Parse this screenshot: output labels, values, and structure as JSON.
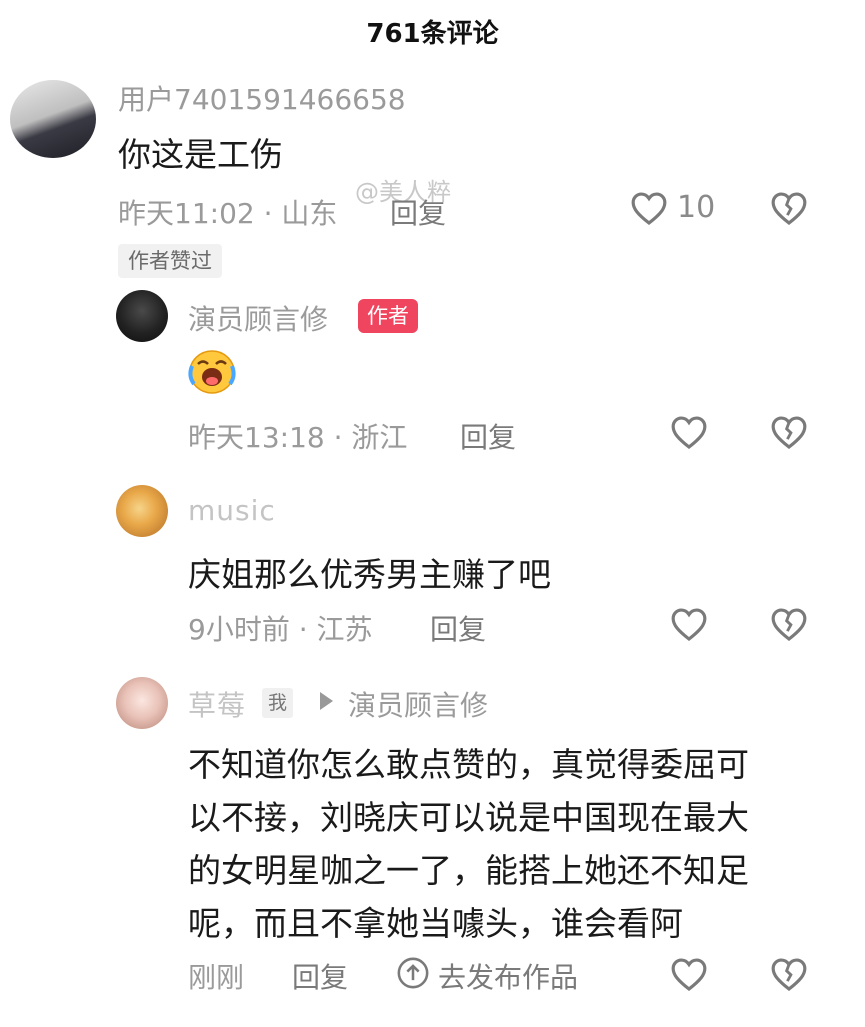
{
  "header": {
    "title": "761条评论"
  },
  "watermark": "@美人粹",
  "comments": [
    {
      "user": "用户7401591466658",
      "text": "你这是工伤",
      "meta": "昨天11:02 · 山东",
      "reply_label": "回复",
      "like_count": "10",
      "badge": "作者赞过"
    },
    {
      "user": "演员顾言修",
      "author_badge": "作者",
      "meta": "昨天13:18 · 浙江",
      "reply_label": "回复"
    },
    {
      "user": "music",
      "text": "庆姐那么优秀男主赚了吧",
      "meta": "9小时前 · 江苏",
      "reply_label": "回复"
    },
    {
      "user": "草莓",
      "me_tag": "我",
      "reply_to": "演员顾言修",
      "text_lines": [
        "不知道你怎么敢点赞的，真觉得委屈可",
        "以不接，刘晓庆可以说是中国现在最大",
        "的女明星咖之一了，能搭上她还不知足",
        "呢，而且不拿她当噱头，谁会看阿"
      ],
      "meta": "刚刚",
      "reply_label": "回复",
      "publish_label": "去发布作品"
    }
  ],
  "icons": {
    "like": "heart-outline-icon",
    "dislike": "broken-heart-icon",
    "publish": "upload-circle-icon",
    "emoji": "laughing-crying-emoji"
  },
  "colors": {
    "author_badge": "#f0455f",
    "muted": "#9a9a9a",
    "text": "#1a1a1a"
  }
}
